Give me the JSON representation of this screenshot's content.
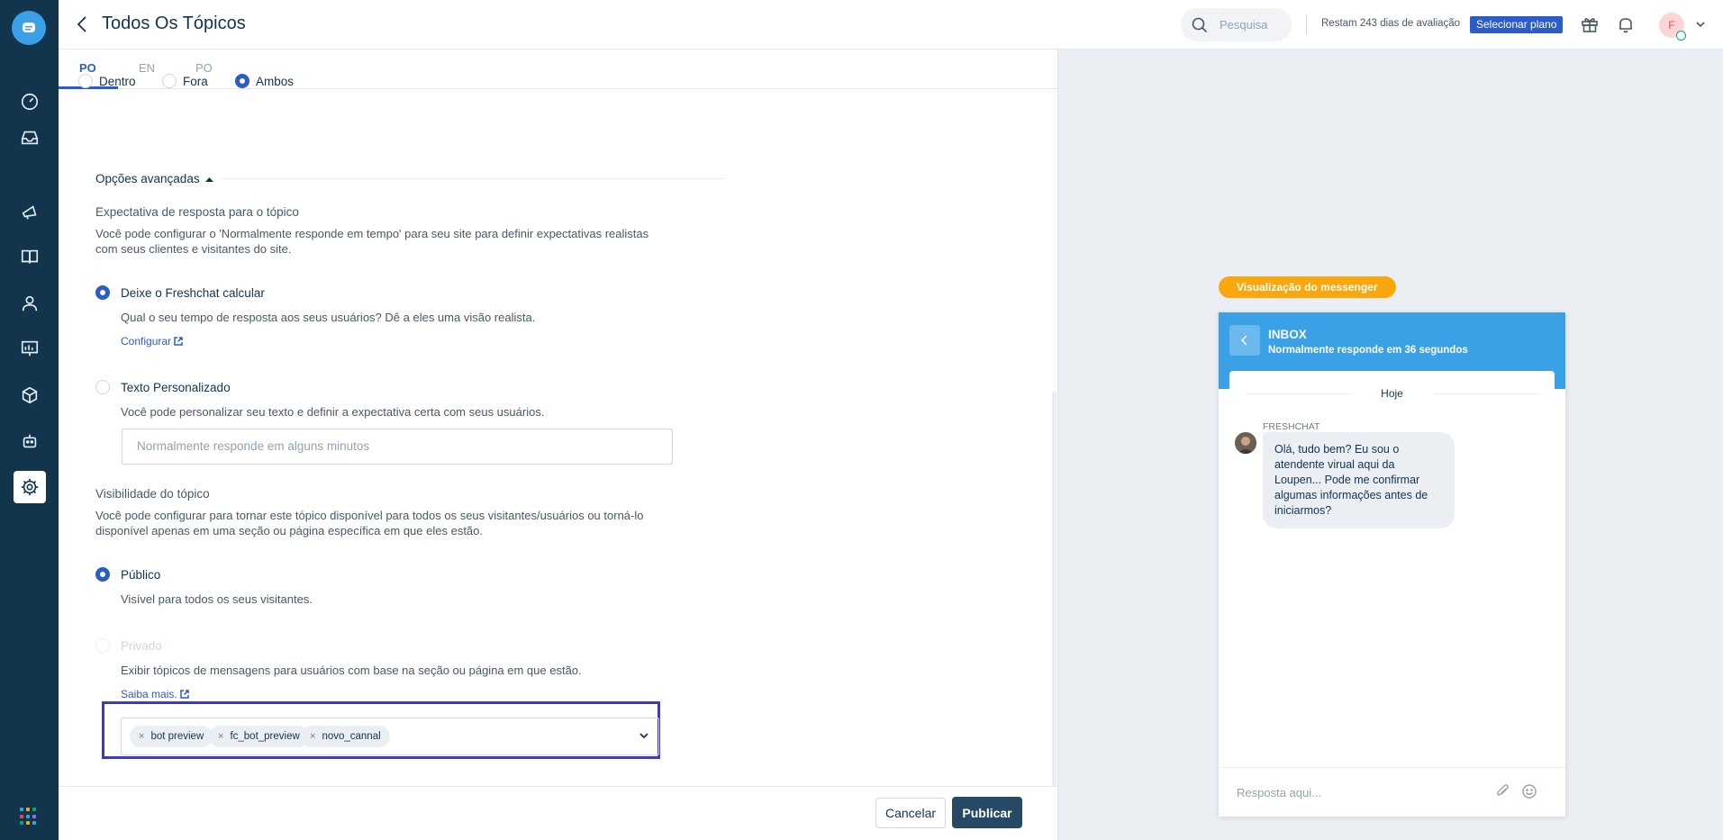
{
  "header": {
    "title": "Todos Os Tópicos",
    "search_placeholder": "Pesquisa",
    "trial_text": "Restam 243 dias de avaliação",
    "select_plan": "Selecionar plano",
    "avatar_initial": "F"
  },
  "tabs": [
    {
      "label": "PO",
      "active": true
    },
    {
      "label": "EN",
      "active": false
    },
    {
      "label": "PO",
      "active": false
    }
  ],
  "location_options": [
    {
      "label": "Dentro",
      "selected": false
    },
    {
      "label": "Fora",
      "selected": false
    },
    {
      "label": "Ambos",
      "selected": true
    }
  ],
  "advanced": {
    "toggle_label": "Opções avançadas",
    "response": {
      "heading": "Expectativa de resposta para o tópico",
      "description": "Você pode configurar o 'Normalmente responde em tempo' para seu site para definir expectativas realistas com seus clientes e visitantes do site.",
      "auto_label": "Deixe o Freshchat calcular",
      "auto_desc": "Qual o seu tempo de resposta aos seus usuários? Dê a eles uma visão realista.",
      "configure_link": "Configurar",
      "custom_label": "Texto Personalizado",
      "custom_desc": "Você pode personalizar seu texto e definir a expectativa certa com seus usuários.",
      "custom_placeholder": "Normalmente responde em alguns minutos"
    },
    "visibility": {
      "heading": "Visibilidade do tópico",
      "description": "Você pode configurar para tornar este tópico disponível para todos os seus visitantes/usuários ou torná-lo disponível apenas em uma seção ou página específica em que eles estão.",
      "public_label": "Público",
      "public_desc": "Visível para todos os seus visitantes.",
      "private_label": "Privado",
      "private_desc": "Exibir tópicos de mensagens para usuários com base na seção ou página em que estão.",
      "learn_more": "Saiba mais.",
      "tags": [
        "bot preview",
        "fc_bot_preview",
        "novo_cannal"
      ]
    }
  },
  "footer": {
    "cancel": "Cancelar",
    "publish": "Publicar"
  },
  "preview": {
    "badge": "Visualização do messenger",
    "inbox_title": "INBOX",
    "inbox_subtitle": "Normalmente responde em 36 segundos",
    "date_label": "Hoje",
    "agent_name": "FRESHCHAT",
    "message": "Olá, tudo bem? Eu sou o atendente virual aqui da Loupen... Pode me confirmar algumas informações antes de iniciarmos?",
    "reply_placeholder": "Resposta aqui..."
  },
  "colors": {
    "rail": "#12344d",
    "accent": "#2c5cc5",
    "messenger": "#3aa1e6",
    "badge": "#f8a80c",
    "highlight": "#3d3bb8"
  }
}
